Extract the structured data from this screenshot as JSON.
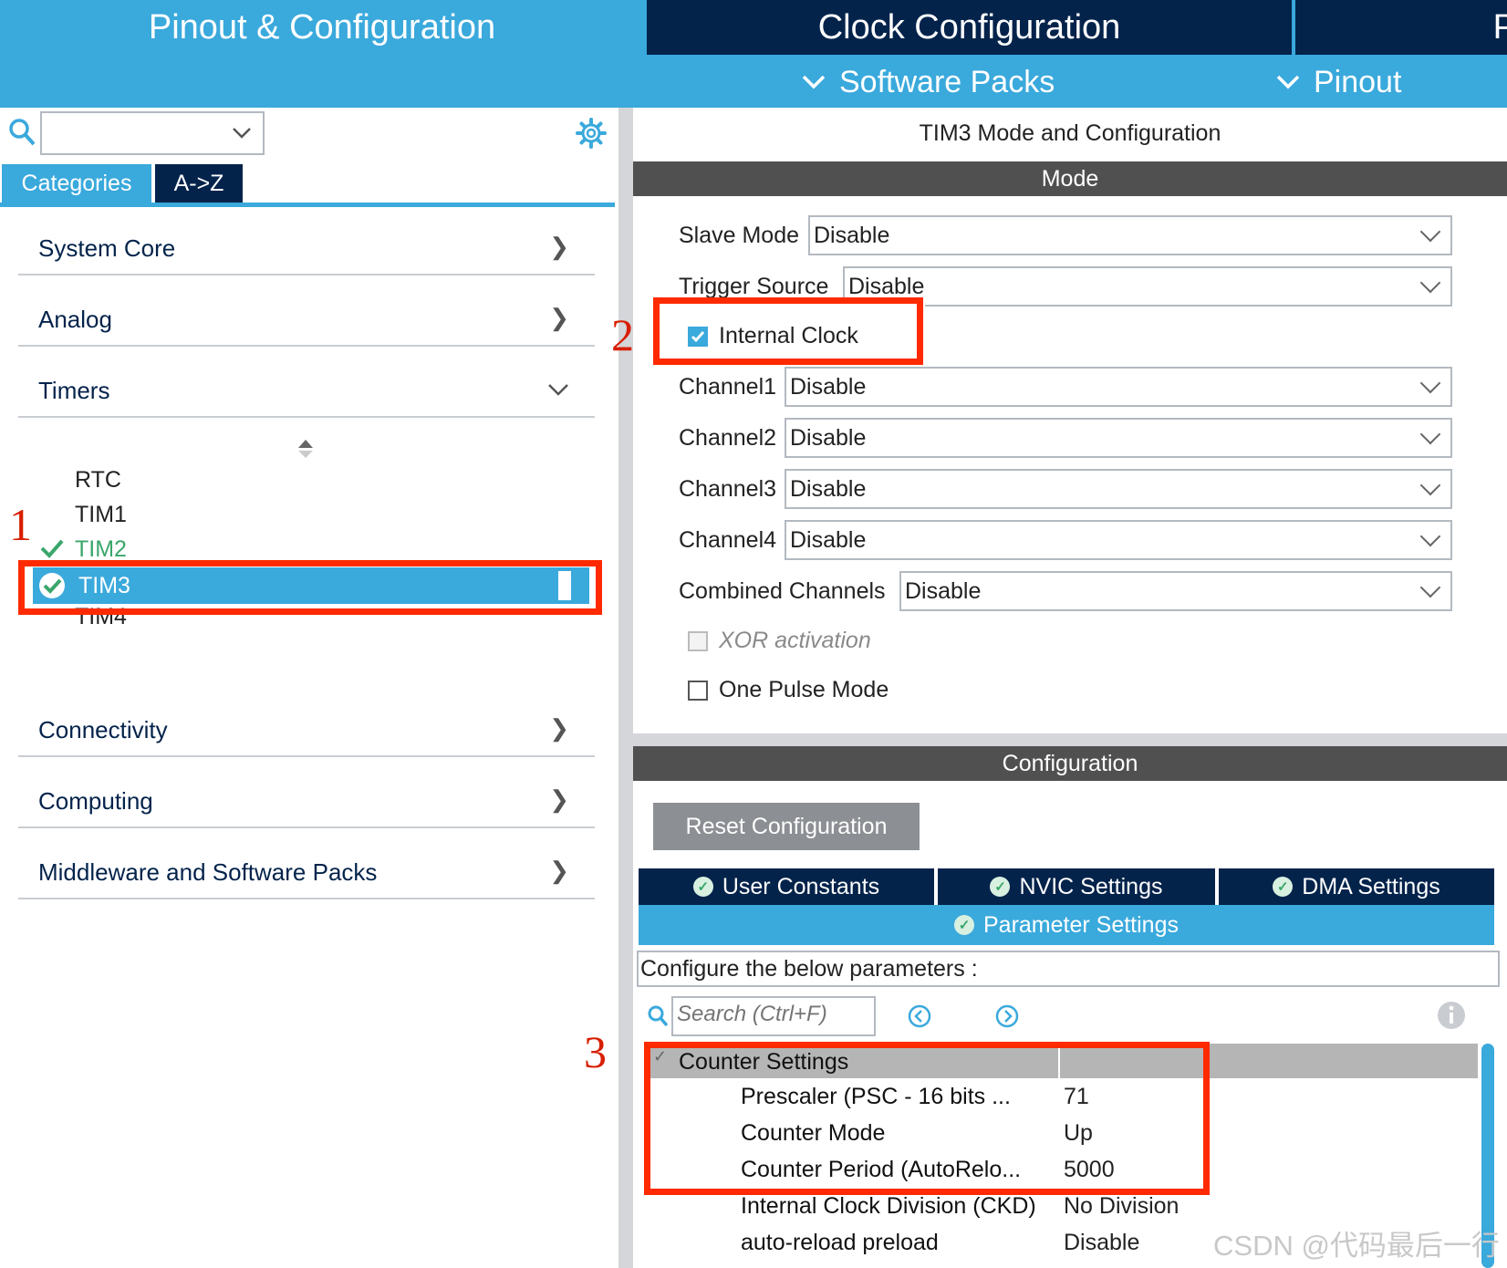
{
  "header": {
    "tab_pinout": "Pinout & Configuration",
    "tab_clock": "Clock Configuration",
    "tab_more": "P",
    "menu_software_packs": "Software Packs",
    "menu_pinout": "Pinout"
  },
  "sidebar": {
    "tab_categories": "Categories",
    "tab_az": "A->Z",
    "categories": {
      "system_core": "System Core",
      "analog": "Analog",
      "timers": "Timers",
      "connectivity": "Connectivity",
      "computing": "Computing",
      "middleware": "Middleware and Software Packs"
    },
    "timers_list": {
      "rtc": "RTC",
      "tim1": "TIM1",
      "tim2": "TIM2",
      "tim3": "TIM3",
      "tim4": "TIM4"
    }
  },
  "mode_panel": {
    "title": "TIM3 Mode and Configuration",
    "mode_header": "Mode",
    "slave_mode_label": "Slave Mode",
    "slave_mode_value": "Disable",
    "trigger_source_label": "Trigger Source",
    "trigger_source_value": "Disable",
    "internal_clock_label": "Internal Clock",
    "internal_clock_checked": true,
    "channel1_label": "Channel1",
    "channel1_value": "Disable",
    "channel2_label": "Channel2",
    "channel2_value": "Disable",
    "channel3_label": "Channel3",
    "channel3_value": "Disable",
    "channel4_label": "Channel4",
    "channel4_value": "Disable",
    "combined_label": "Combined Channels",
    "combined_value": "Disable",
    "xor_label": "XOR activation",
    "one_pulse_label": "One Pulse Mode"
  },
  "config_panel": {
    "header": "Configuration",
    "reset_button": "Reset Configuration",
    "tab_user_constants": "User Constants",
    "tab_nvic": "NVIC Settings",
    "tab_dma": "DMA Settings",
    "tab_parameter": "Parameter Settings",
    "configure_text": "Configure the below parameters :",
    "search_placeholder": "Search (Ctrl+F)",
    "group_counter": "Counter Settings",
    "params": {
      "prescaler_label": "Prescaler (PSC - 16 bits ...",
      "prescaler_value": "71",
      "counter_mode_label": "Counter Mode",
      "counter_mode_value": "Up",
      "period_label": "Counter Period (AutoRelo...",
      "period_value": "5000",
      "ckd_label": "Internal Clock Division (CKD)",
      "ckd_value": "No Division",
      "preload_label": "auto-reload preload",
      "preload_value": "Disable"
    }
  },
  "annotations": {
    "n1": "1",
    "n2": "2",
    "n3": "3"
  },
  "watermark": "CSDN @代码最后一行",
  "colors": {
    "accent_blue": "#3aa9dc",
    "dark_navy": "#03234b",
    "header_gray": "#505050",
    "annotation_red": "#ff2a00",
    "ok_green": "#3aa66b"
  }
}
